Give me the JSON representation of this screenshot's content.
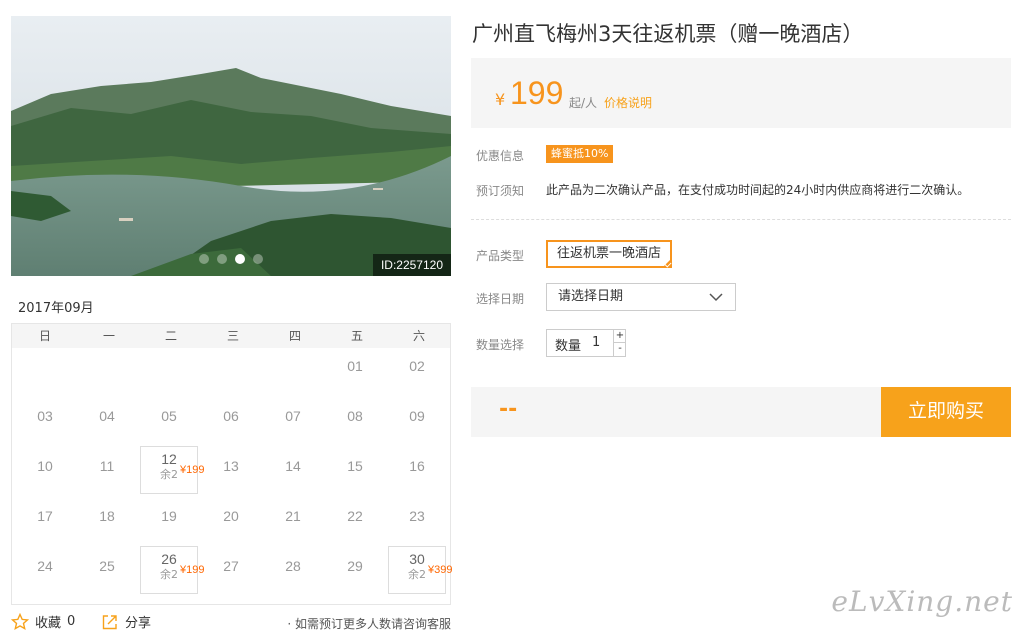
{
  "gallery": {
    "image_id": "ID:2257120",
    "slide_count": 4,
    "active_slide": 3
  },
  "calendar": {
    "tab_label": "2017年09月",
    "weekdays": [
      "日",
      "一",
      "二",
      "三",
      "四",
      "五",
      "六"
    ],
    "weeks": [
      [
        {
          "d": ""
        },
        {
          "d": ""
        },
        {
          "d": ""
        },
        {
          "d": ""
        },
        {
          "d": ""
        },
        {
          "d": "01"
        },
        {
          "d": "02"
        }
      ],
      [
        {
          "d": "03"
        },
        {
          "d": "04"
        },
        {
          "d": "05"
        },
        {
          "d": "06"
        },
        {
          "d": "07"
        },
        {
          "d": "08"
        },
        {
          "d": "09"
        }
      ],
      [
        {
          "d": "10"
        },
        {
          "d": "11"
        },
        {
          "d": "12",
          "price": "¥199",
          "stock": "余2"
        },
        {
          "d": "13"
        },
        {
          "d": "14"
        },
        {
          "d": "15"
        },
        {
          "d": "16"
        }
      ],
      [
        {
          "d": "17"
        },
        {
          "d": "18"
        },
        {
          "d": "19"
        },
        {
          "d": "20"
        },
        {
          "d": "21"
        },
        {
          "d": "22"
        },
        {
          "d": "23"
        }
      ],
      [
        {
          "d": "24"
        },
        {
          "d": "25"
        },
        {
          "d": "26",
          "price": "¥199",
          "stock": "余2"
        },
        {
          "d": "27"
        },
        {
          "d": "28"
        },
        {
          "d": "29"
        },
        {
          "d": "30",
          "price": "¥399",
          "stock": "余2"
        }
      ]
    ]
  },
  "actions": {
    "favorite_label": "收藏",
    "favorite_count": "0",
    "share_label": "分享",
    "note": "· 如需预订更多人数请咨询客服"
  },
  "product": {
    "title": "广州直飞梅州3天往返机票（赠一晚酒店）",
    "currency": "¥",
    "price": "199",
    "price_unit": "起/人",
    "price_note": "价格说明"
  },
  "info": {
    "promo_label": "优惠信息",
    "promo_badge": "蜂蜜抵10%",
    "notice_label": "预订须知",
    "notice_text": "此产品为二次确认产品，在支付成功时间起的24小时内供应商将进行二次确认。"
  },
  "options": {
    "type_label": "产品类型",
    "type_value": "往返机票一晚酒店",
    "date_label": "选择日期",
    "date_placeholder": "请选择日期",
    "qty_label": "数量选择",
    "qty_inner_label": "数量",
    "qty_value": "1",
    "qty_plus": "+",
    "qty_minus": "-"
  },
  "purchase": {
    "total": "--",
    "buy_label": "立即购买"
  },
  "watermark": "eLvXing.net",
  "colors": {
    "accent": "#f7941d",
    "button": "#f7a21b",
    "price_small": "#ff6600"
  }
}
